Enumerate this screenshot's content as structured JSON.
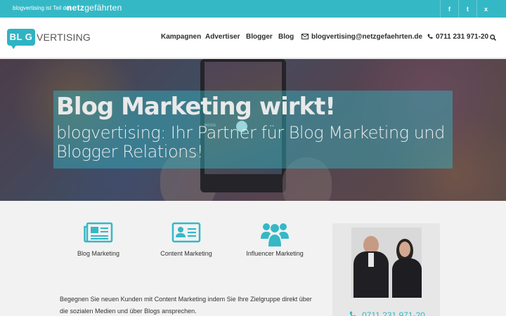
{
  "topbar": {
    "note": "blogvertising ist Teil der",
    "partner_logo_bold": "netz",
    "partner_logo_rest": "gefährten",
    "social": [
      {
        "icon": "facebook-icon",
        "glyph": "f"
      },
      {
        "icon": "twitter-icon",
        "glyph": "t"
      },
      {
        "icon": "xing-icon",
        "glyph": "x"
      }
    ]
  },
  "header": {
    "logo_bubble": "BL G",
    "logo_rest": "VERTISING",
    "nav": {
      "kampagnen": "Kampagnen",
      "advertiser": "Advertiser",
      "blogger": "Blogger",
      "blog": "Blog",
      "email": "blogvertising@netzgefaehrten.de",
      "phone": "0711 231 971-20"
    }
  },
  "hero": {
    "title": "Blog Marketing wirkt!",
    "subtitle": "blogvertising: Ihr Partner für Blog Marketing und Blogger Relations!",
    "phone_mode": "MODE"
  },
  "services": [
    {
      "label": "Blog Marketing",
      "icon": "newspaper-icon"
    },
    {
      "label": "Content Marketing",
      "icon": "id-card-icon"
    },
    {
      "label": "Influencer Marketing",
      "icon": "users-icon"
    }
  ],
  "body_text": "Begegnen Sie neuen Kunden mit Content Marketing indem Sie Ihre Zielgruppe direkt über die sozialen Medien und über Blogs ansprechen.",
  "contact": {
    "phone": "0711 231 971-20"
  },
  "colors": {
    "accent": "#35b8c6",
    "topbar": "#35b8c6",
    "text": "#2d2d2d"
  }
}
